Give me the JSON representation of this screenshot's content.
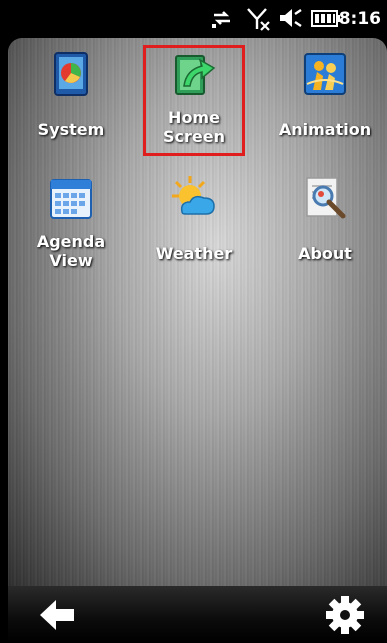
{
  "status_bar": {
    "time": "8:16",
    "icons": [
      "data-transfer-icon",
      "no-signal-icon",
      "speaker-icon",
      "battery-icon"
    ]
  },
  "grid": {
    "items": [
      {
        "label": "System",
        "icon": "system-icon",
        "selected": false
      },
      {
        "label": "Home\nScreen",
        "icon": "home-screen-icon",
        "selected": true
      },
      {
        "label": "Animation",
        "icon": "animation-icon",
        "selected": false
      },
      {
        "label": "Agenda\nView",
        "icon": "agenda-view-icon",
        "selected": false
      },
      {
        "label": "Weather",
        "icon": "weather-icon",
        "selected": false
      },
      {
        "label": "About",
        "icon": "about-icon",
        "selected": false
      }
    ]
  },
  "bottom_bar": {
    "left": "back-arrow-icon",
    "right": "settings-gear-icon"
  },
  "colors": {
    "selection": "#e01e1e"
  }
}
